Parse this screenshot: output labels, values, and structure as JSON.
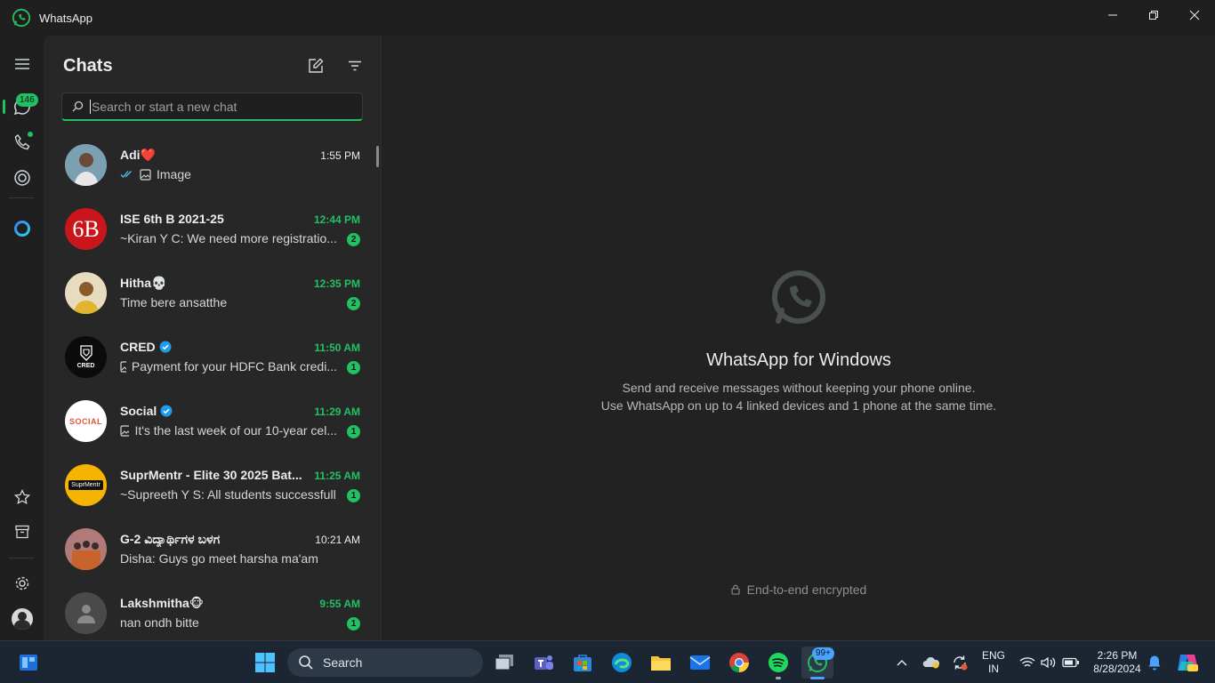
{
  "window": {
    "title": "WhatsApp"
  },
  "rail": {
    "chats_badge": "146"
  },
  "chatlist": {
    "title": "Chats",
    "search_placeholder": "Search or start a new chat",
    "chats": [
      {
        "name": "Adi❤️",
        "time": "1:55 PM",
        "preview": "Image",
        "unread": "",
        "avatar_color": "#5b7b8c"
      },
      {
        "name": "ISE 6th  B 2021-25",
        "time": "12:44 PM",
        "preview": "~Kiran Y C: We need more registratio...",
        "unread": "2",
        "avatar_text": "6B",
        "avatar_color": "#c8161b"
      },
      {
        "name": "Hitha💀",
        "time": "12:35 PM",
        "preview": "Time bere ansatthe",
        "unread": "2",
        "avatar_color": "#c7a24a"
      },
      {
        "name": "CRED",
        "time": "11:50 AM",
        "preview": "Payment for your HDFC Bank credi...",
        "unread": "1",
        "avatar_text": "CRED",
        "avatar_color": "#0b0b0b"
      },
      {
        "name": "Social",
        "time": "11:29 AM",
        "preview": "It's the last week of our 10-year cel...",
        "unread": "1",
        "avatar_text": "SOCIAL",
        "avatar_color": "#ffffff"
      },
      {
        "name": "SuprMentr - Elite 30 2025 Bat...",
        "time": "11:25 AM",
        "preview": "~Supreeth Y S: All students successfull...",
        "unread": "1",
        "avatar_text": "SuprMentr",
        "avatar_color": "#f4b400"
      },
      {
        "name": "G-2 ವಿದ್ಯಾರ್ಥಿಗಳ ಬಳಗ",
        "time": "10:21 AM",
        "preview": "Disha: Guys go meet harsha ma'am",
        "unread": "",
        "avatar_color": "#7a5a4a"
      },
      {
        "name": "Lakshmitha🐵",
        "time": "9:55 AM",
        "preview": "nan ondh bitte",
        "unread": "1",
        "avatar_color": "#4a4a4a"
      }
    ]
  },
  "main": {
    "heading": "WhatsApp for Windows",
    "line1": "Send and receive messages without keeping your phone online.",
    "line2": "Use WhatsApp on up to 4 linked devices and 1 phone at the same time.",
    "encrypted": "End-to-end encrypted"
  },
  "taskbar": {
    "search_label": "Search",
    "whatsapp_badge": "99+",
    "lang_top": "ENG",
    "lang_bottom": "IN",
    "clock_time": "2:26 PM",
    "clock_date": "8/28/2024"
  },
  "colors": {
    "accent": "#21c063",
    "pane": "#272727",
    "main_bg": "#222222"
  }
}
